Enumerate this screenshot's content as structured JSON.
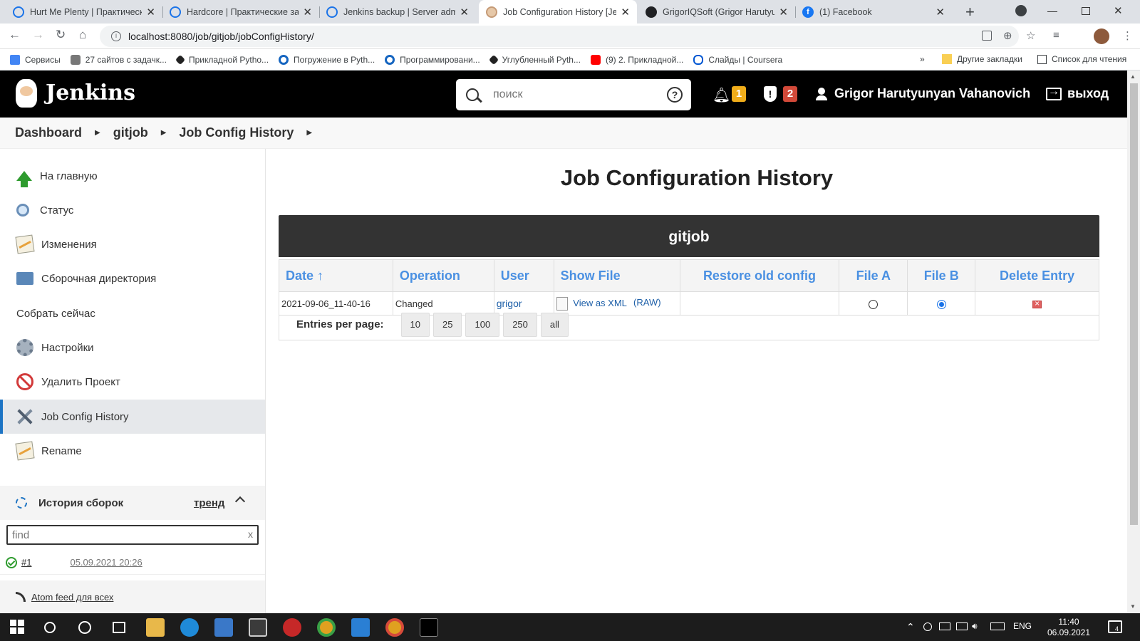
{
  "browser": {
    "tabs": [
      {
        "label": "Hurt Me Plenty | Практическ",
        "icon": "circle-icon",
        "active": false
      },
      {
        "label": "Hardcore | Практические зад",
        "icon": "circle-icon",
        "active": false
      },
      {
        "label": "Jenkins backup | Server admin",
        "icon": "circle-icon",
        "active": false
      },
      {
        "label": "Job Configuration History [Jer",
        "icon": "jenkins-icon",
        "active": true
      },
      {
        "label": "GrigorIQSoft (Grigor Harutyur",
        "icon": "github-icon",
        "active": false
      },
      {
        "label": "(1) Facebook",
        "icon": "facebook-icon",
        "active": false
      }
    ],
    "close_glyph": "✕",
    "new_tab_glyph": "+",
    "url": "localhost:8080/job/gitjob/jobConfigHistory/",
    "bookmarks": [
      {
        "label": "Сервисы",
        "icon": "apps-icon"
      },
      {
        "label": "27 сайтов с задачк...",
        "icon": "gray-icon"
      },
      {
        "label": "Прикладной Pytho...",
        "icon": "diamond-icon"
      },
      {
        "label": "Погружение в Pyth...",
        "icon": "c-icon"
      },
      {
        "label": "Программировани...",
        "icon": "c-icon"
      },
      {
        "label": "Углубленный Pyth...",
        "icon": "diamond-icon"
      },
      {
        "label": "(9) 2. Прикладной...",
        "icon": "youtube-icon"
      },
      {
        "label": "Слайды | Coursera",
        "icon": "coursera-icon"
      }
    ],
    "bookmarks_more": "»",
    "other_bookmarks": "Другие закладки",
    "reading_list": "Список для чтения"
  },
  "jenkins": {
    "brand": "Jenkins",
    "search_placeholder": "поиск",
    "help_glyph": "?",
    "notifications_count": "1",
    "security_count": "2",
    "user_name": "Grigor Harutyunyan Vahanovich",
    "logout_label": "выход"
  },
  "breadcrumb": [
    {
      "label": "Dashboard"
    },
    {
      "label": "gitjob"
    },
    {
      "label": "Job Config History"
    }
  ],
  "breadcrumb_sep": "▶",
  "sidebar": {
    "items": [
      {
        "label": "На главную",
        "icon": "up-arrow-icon"
      },
      {
        "label": "Статус",
        "icon": "magnifier-icon"
      },
      {
        "label": "Изменения",
        "icon": "notepad-icon"
      },
      {
        "label": "Сборочная директория",
        "icon": "folder-icon"
      },
      {
        "label": "Собрать сейчас",
        "icon": "clock-icon"
      },
      {
        "label": "Настройки",
        "icon": "gear-icon"
      },
      {
        "label": "Удалить Проект",
        "icon": "no-entry-icon"
      },
      {
        "label": "Job Config History",
        "icon": "tools-icon"
      },
      {
        "label": "Rename",
        "icon": "notepad-icon"
      }
    ],
    "active_index": 7,
    "build_history": {
      "title": "История сборок",
      "trend_label": "тренд",
      "find_placeholder": "find",
      "clear_glyph": "x",
      "builds": [
        {
          "number": "#1",
          "date": "05.09.2021 20:26",
          "status": "success"
        }
      ],
      "atom_feed": "Atom feed для всех"
    }
  },
  "main": {
    "title": "Job Configuration History",
    "job_name": "gitjob",
    "columns": [
      "Date ↑",
      "Operation",
      "User",
      "Show File",
      "Restore old config",
      "File A",
      "File B",
      "Delete Entry"
    ],
    "rows": [
      {
        "date": "2021-09-06_11-40-16",
        "operation": "Changed",
        "user": "grigor",
        "show_file_xml": "View as XML",
        "show_file_raw": "(RAW)",
        "restore": "",
        "file_a_selected": false,
        "file_b_selected": true
      }
    ],
    "entries_label": "Entries per page:",
    "page_sizes": [
      "10",
      "25",
      "100",
      "250",
      "all"
    ]
  },
  "taskbar": {
    "lang": "ENG",
    "time": "11:40",
    "date": "06.09.2021",
    "notification_count": "4",
    "tray_up": "⌃"
  }
}
